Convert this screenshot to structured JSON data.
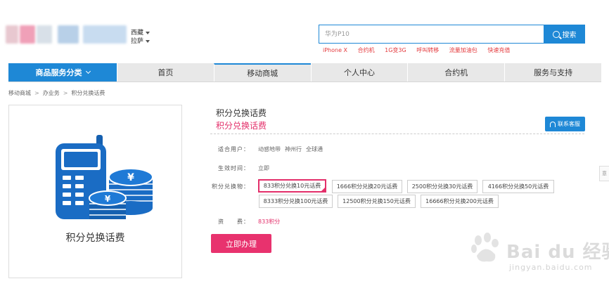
{
  "header": {
    "region": {
      "line1": "西藏",
      "line2": "拉萨"
    },
    "search": {
      "placeholder": "华为P10",
      "button_label": "搜索"
    },
    "hot_links": [
      "iPhone X",
      "合约机",
      "1G变3G",
      "呼叫转移",
      "流量加油包",
      "快速充值"
    ]
  },
  "nav": {
    "items": [
      {
        "label": "商品服务分类"
      },
      {
        "label": "首页"
      },
      {
        "label": "移动商城"
      },
      {
        "label": "个人中心"
      },
      {
        "label": "合约机"
      },
      {
        "label": "服务与支持"
      }
    ]
  },
  "breadcrumb": [
    "移动商城",
    "办业务",
    "积分兑换话费"
  ],
  "product": {
    "image_caption": "积分兑换话费",
    "title": "积分兑换话费",
    "subtitle": "积分兑换话费",
    "service_button": "联系客服",
    "fields": {
      "users_label": "适合用户：",
      "users": [
        "动感地带",
        "神州行",
        "全球通"
      ],
      "effective_label": "生效时间：",
      "effective": "立即",
      "redeem_label": "积分兑换物：",
      "options": [
        "833积分兑换10元话费",
        "1666积分兑换20元话费",
        "2500积分兑换30元话费",
        "4166积分兑换50元话费",
        "8333积分兑换100元话费",
        "12500积分兑换150元话费",
        "16666积分兑换200元话费"
      ],
      "selected_option": "833积分兑换10元话费",
      "fee_label": "资　　费：",
      "fee": "833积分"
    },
    "apply_button": "立即办理"
  },
  "side_tab": "意",
  "watermark": {
    "text": "Bai du 经验",
    "url": "jingyan.baidu.com"
  },
  "colors": {
    "brand_blue": "#1e88d6",
    "accent_pink": "#e32f6a",
    "hot_red": "#e4393c"
  }
}
